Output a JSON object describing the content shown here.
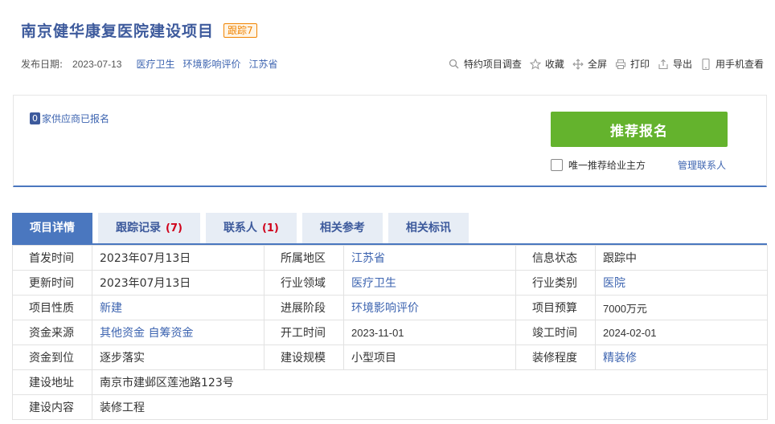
{
  "header": {
    "title": "南京健华康复医院建设项目",
    "badge": "跟踪7",
    "date_label": "发布日期:",
    "date": "2023-07-13",
    "tags": [
      "医疗卫生",
      "环境影响评价",
      "江苏省"
    ]
  },
  "actions": [
    {
      "label": "特约项目调查",
      "icon": "search-doc-icon"
    },
    {
      "label": "收藏",
      "icon": "star-icon"
    },
    {
      "label": "全屏",
      "icon": "move-arrows-icon"
    },
    {
      "label": "打印",
      "icon": "printer-icon"
    },
    {
      "label": "导出",
      "icon": "export-icon"
    },
    {
      "label": "用手机查看",
      "icon": "mobile-icon"
    }
  ],
  "signup": {
    "count": "0",
    "count_text": "家供应商已报名",
    "button": "推荐报名",
    "checkbox_label": "唯一推荐给业主方",
    "manage_contacts": "管理联系人"
  },
  "tabs": [
    {
      "label": "项目详情",
      "count": ""
    },
    {
      "label": "跟踪记录",
      "count": "(7)"
    },
    {
      "label": "联系人",
      "count": "(1)"
    },
    {
      "label": "相关参考",
      "count": ""
    },
    {
      "label": "相关标讯",
      "count": ""
    }
  ],
  "details": {
    "r1": {
      "k1": "首发时间",
      "v1": "2023年07月13日",
      "k2": "所属地区",
      "v2": "江苏省",
      "k3": "信息状态",
      "v3": "跟踪中"
    },
    "r2": {
      "k1": "更新时间",
      "v1": "2023年07月13日",
      "k2": "行业领域",
      "v2": "医疗卫生",
      "k3": "行业类别",
      "v3": "医院"
    },
    "r3": {
      "k1": "项目性质",
      "v1": "新建",
      "k2": "进展阶段",
      "v2": "环境影响评价",
      "k3": "项目预算",
      "v3": "7000万元"
    },
    "r4": {
      "k1": "资金来源",
      "v1": "其他资金 自筹资金",
      "k2": "开工时间",
      "v2": "2023-11-01",
      "k3": "竣工时间",
      "v3": "2024-02-01"
    },
    "r5": {
      "k1": "资金到位",
      "v1": "逐步落实",
      "k2": "建设规模",
      "v2": "小型项目",
      "k3": "装修程度",
      "v3": "精装修"
    },
    "r6": {
      "k1": "建设地址",
      "v1": "南京市建邺区莲池路123号"
    },
    "r7": {
      "k1": "建设内容",
      "v1": "装修工程"
    }
  }
}
